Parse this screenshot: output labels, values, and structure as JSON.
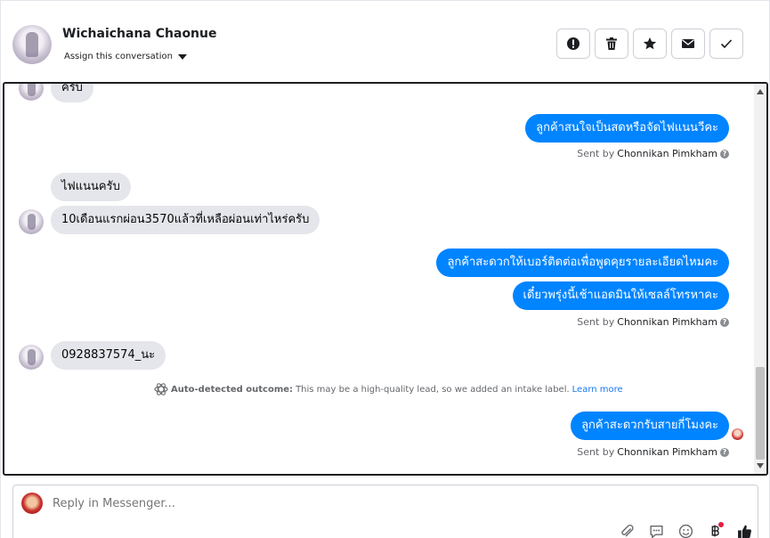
{
  "header": {
    "contact_name": "Wichaichana Chaonue",
    "assign_label": "Assign this conversation",
    "actions": [
      "alert-icon",
      "trash-icon",
      "star-icon",
      "envelope-icon",
      "check-icon"
    ]
  },
  "thread": {
    "messages": [
      {
        "dir": "in",
        "text": "ครับ"
      },
      {
        "dir": "out",
        "text": "ลูกค้าสนใจเป็นสดหรือจัดไฟแนนวีคะ"
      },
      {
        "dir": "in",
        "text": "ไฟแนนครับ"
      },
      {
        "dir": "in",
        "text": "10เดือนแรกผ่อน3570แล้วที่เหลือผ่อนเท่าไหร่ครับ"
      },
      {
        "dir": "out",
        "text": "ลูกค้าสะดวกให้เบอร์ติดต่อเพื่อพูดคุยรายละเอียดไหมคะ"
      },
      {
        "dir": "out",
        "text": "เดี๋ยวพรุ่งนี้เช้าแอดมินให้เซลล์โทรหาคะ"
      },
      {
        "dir": "in",
        "text": "0928837574_นะ"
      },
      {
        "dir": "out",
        "text": "ลูกค้าสะดวกรับสายกี่โมงคะ"
      }
    ],
    "sent_prefix": "Sent by",
    "sent_by": "Chonnikan Pimkham",
    "help_mark": "?",
    "auto_detected": {
      "label": "Auto-detected outcome:",
      "text": "This may be a high-quality lead, so we added an intake label.",
      "link": "Learn more"
    }
  },
  "composer": {
    "placeholder": "Reply in Messenger..."
  },
  "colors": {
    "outgoing": "#0084ff",
    "incoming": "#e4e6eb",
    "link": "#1877f2"
  }
}
